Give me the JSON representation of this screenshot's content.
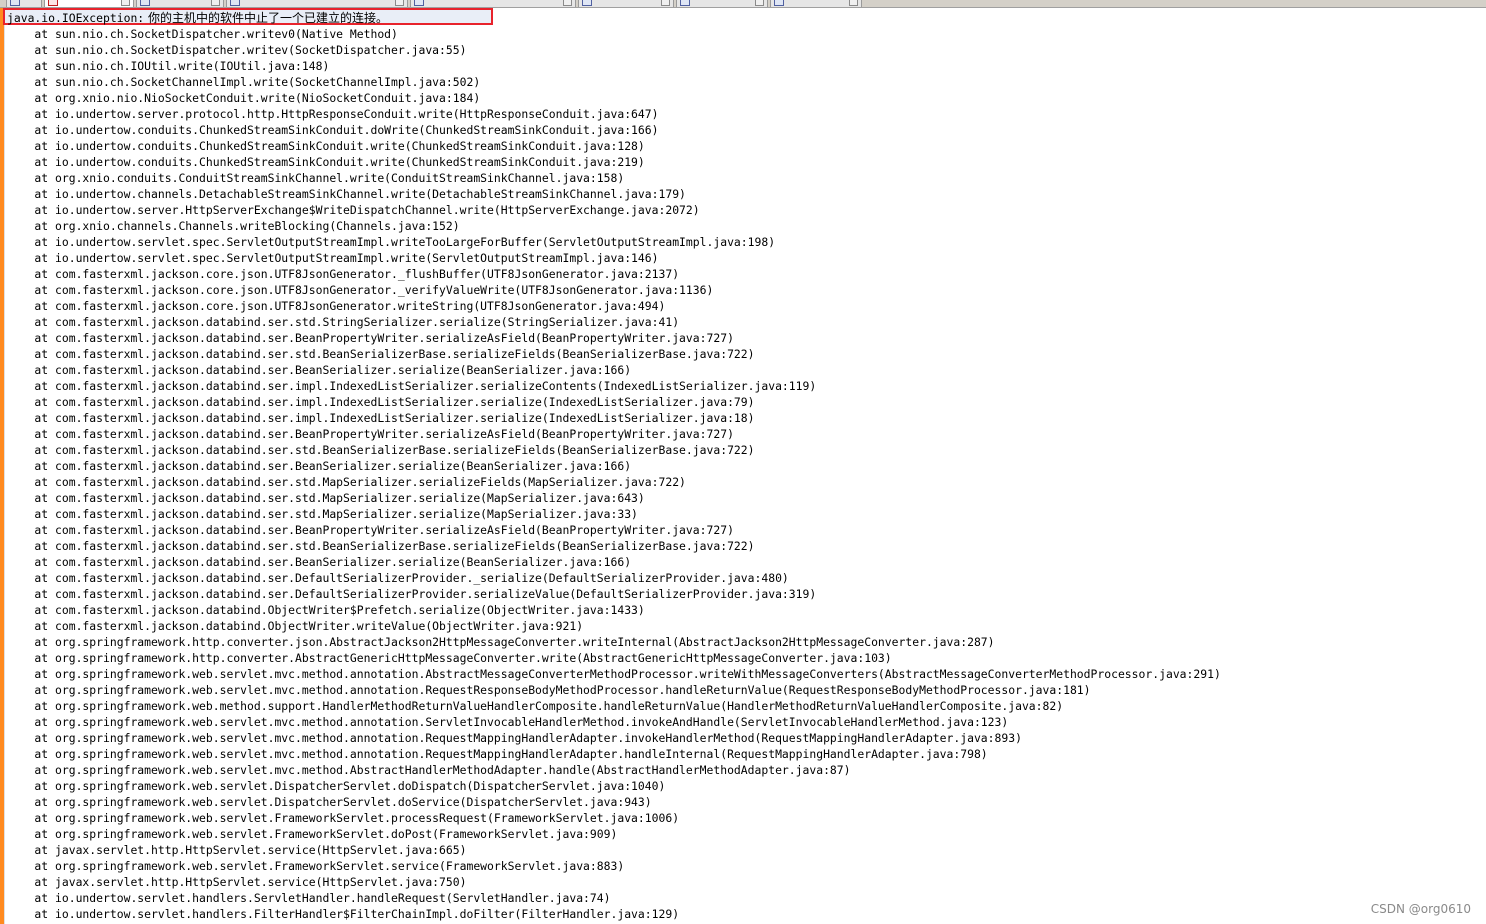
{
  "exception": {
    "class_prefix": "java.io.IOException:",
    "message": " 你的主机中的软件中止了一个已建立的连接。"
  },
  "stack": [
    "    at sun.nio.ch.SocketDispatcher.writev0(Native Method)",
    "    at sun.nio.ch.SocketDispatcher.writev(SocketDispatcher.java:55)",
    "    at sun.nio.ch.IOUtil.write(IOUtil.java:148)",
    "    at sun.nio.ch.SocketChannelImpl.write(SocketChannelImpl.java:502)",
    "    at org.xnio.nio.NioSocketConduit.write(NioSocketConduit.java:184)",
    "    at io.undertow.server.protocol.http.HttpResponseConduit.write(HttpResponseConduit.java:647)",
    "    at io.undertow.conduits.ChunkedStreamSinkConduit.doWrite(ChunkedStreamSinkConduit.java:166)",
    "    at io.undertow.conduits.ChunkedStreamSinkConduit.write(ChunkedStreamSinkConduit.java:128)",
    "    at io.undertow.conduits.ChunkedStreamSinkConduit.write(ChunkedStreamSinkConduit.java:219)",
    "    at org.xnio.conduits.ConduitStreamSinkChannel.write(ConduitStreamSinkChannel.java:158)",
    "    at io.undertow.channels.DetachableStreamSinkChannel.write(DetachableStreamSinkChannel.java:179)",
    "    at io.undertow.server.HttpServerExchange$WriteDispatchChannel.write(HttpServerExchange.java:2072)",
    "    at org.xnio.channels.Channels.writeBlocking(Channels.java:152)",
    "    at io.undertow.servlet.spec.ServletOutputStreamImpl.writeTooLargeForBuffer(ServletOutputStreamImpl.java:198)",
    "    at io.undertow.servlet.spec.ServletOutputStreamImpl.write(ServletOutputStreamImpl.java:146)",
    "    at com.fasterxml.jackson.core.json.UTF8JsonGenerator._flushBuffer(UTF8JsonGenerator.java:2137)",
    "    at com.fasterxml.jackson.core.json.UTF8JsonGenerator._verifyValueWrite(UTF8JsonGenerator.java:1136)",
    "    at com.fasterxml.jackson.core.json.UTF8JsonGenerator.writeString(UTF8JsonGenerator.java:494)",
    "    at com.fasterxml.jackson.databind.ser.std.StringSerializer.serialize(StringSerializer.java:41)",
    "    at com.fasterxml.jackson.databind.ser.BeanPropertyWriter.serializeAsField(BeanPropertyWriter.java:727)",
    "    at com.fasterxml.jackson.databind.ser.std.BeanSerializerBase.serializeFields(BeanSerializerBase.java:722)",
    "    at com.fasterxml.jackson.databind.ser.BeanSerializer.serialize(BeanSerializer.java:166)",
    "    at com.fasterxml.jackson.databind.ser.impl.IndexedListSerializer.serializeContents(IndexedListSerializer.java:119)",
    "    at com.fasterxml.jackson.databind.ser.impl.IndexedListSerializer.serialize(IndexedListSerializer.java:79)",
    "    at com.fasterxml.jackson.databind.ser.impl.IndexedListSerializer.serialize(IndexedListSerializer.java:18)",
    "    at com.fasterxml.jackson.databind.ser.BeanPropertyWriter.serializeAsField(BeanPropertyWriter.java:727)",
    "    at com.fasterxml.jackson.databind.ser.std.BeanSerializerBase.serializeFields(BeanSerializerBase.java:722)",
    "    at com.fasterxml.jackson.databind.ser.BeanSerializer.serialize(BeanSerializer.java:166)",
    "    at com.fasterxml.jackson.databind.ser.std.MapSerializer.serializeFields(MapSerializer.java:722)",
    "    at com.fasterxml.jackson.databind.ser.std.MapSerializer.serialize(MapSerializer.java:643)",
    "    at com.fasterxml.jackson.databind.ser.std.MapSerializer.serialize(MapSerializer.java:33)",
    "    at com.fasterxml.jackson.databind.ser.BeanPropertyWriter.serializeAsField(BeanPropertyWriter.java:727)",
    "    at com.fasterxml.jackson.databind.ser.std.BeanSerializerBase.serializeFields(BeanSerializerBase.java:722)",
    "    at com.fasterxml.jackson.databind.ser.BeanSerializer.serialize(BeanSerializer.java:166)",
    "    at com.fasterxml.jackson.databind.ser.DefaultSerializerProvider._serialize(DefaultSerializerProvider.java:480)",
    "    at com.fasterxml.jackson.databind.ser.DefaultSerializerProvider.serializeValue(DefaultSerializerProvider.java:319)",
    "    at com.fasterxml.jackson.databind.ObjectWriter$Prefetch.serialize(ObjectWriter.java:1433)",
    "    at com.fasterxml.jackson.databind.ObjectWriter.writeValue(ObjectWriter.java:921)",
    "    at org.springframework.http.converter.json.AbstractJackson2HttpMessageConverter.writeInternal(AbstractJackson2HttpMessageConverter.java:287)",
    "    at org.springframework.http.converter.AbstractGenericHttpMessageConverter.write(AbstractGenericHttpMessageConverter.java:103)",
    "    at org.springframework.web.servlet.mvc.method.annotation.AbstractMessageConverterMethodProcessor.writeWithMessageConverters(AbstractMessageConverterMethodProcessor.java:291)",
    "    at org.springframework.web.servlet.mvc.method.annotation.RequestResponseBodyMethodProcessor.handleReturnValue(RequestResponseBodyMethodProcessor.java:181)",
    "    at org.springframework.web.method.support.HandlerMethodReturnValueHandlerComposite.handleReturnValue(HandlerMethodReturnValueHandlerComposite.java:82)",
    "    at org.springframework.web.servlet.mvc.method.annotation.ServletInvocableHandlerMethod.invokeAndHandle(ServletInvocableHandlerMethod.java:123)",
    "    at org.springframework.web.servlet.mvc.method.annotation.RequestMappingHandlerAdapter.invokeHandlerMethod(RequestMappingHandlerAdapter.java:893)",
    "    at org.springframework.web.servlet.mvc.method.annotation.RequestMappingHandlerAdapter.handleInternal(RequestMappingHandlerAdapter.java:798)",
    "    at org.springframework.web.servlet.mvc.method.AbstractHandlerMethodAdapter.handle(AbstractHandlerMethodAdapter.java:87)",
    "    at org.springframework.web.servlet.DispatcherServlet.doDispatch(DispatcherServlet.java:1040)",
    "    at org.springframework.web.servlet.DispatcherServlet.doService(DispatcherServlet.java:943)",
    "    at org.springframework.web.servlet.FrameworkServlet.processRequest(FrameworkServlet.java:1006)",
    "    at org.springframework.web.servlet.FrameworkServlet.doPost(FrameworkServlet.java:909)",
    "    at javax.servlet.http.HttpServlet.service(HttpServlet.java:665)",
    "    at org.springframework.web.servlet.FrameworkServlet.service(FrameworkServlet.java:883)",
    "    at javax.servlet.http.HttpServlet.service(HttpServlet.java:750)",
    "    at io.undertow.servlet.handlers.ServletHandler.handleRequest(ServletHandler.java:74)",
    "    at io.undertow.servlet.handlers.FilterHandler$FilterChainImpl.doFilter(FilterHandler.java:129)"
  ],
  "watermark": "CSDN @org0610",
  "colors": {
    "highlight_border": "#e8232c",
    "change_bar": "#ff8a1f",
    "current_line": "#e9eef7"
  }
}
